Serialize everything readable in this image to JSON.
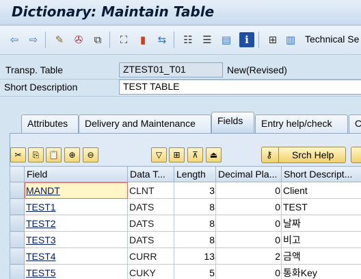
{
  "window": {
    "title": "Dictionary: Maintain Table"
  },
  "toolbar": {
    "buttons": [
      {
        "name": "back-arrow-icon",
        "glyph": "⇦",
        "color": "#3b73c9"
      },
      {
        "name": "forward-arrow-icon",
        "glyph": "⇨",
        "color": "#3b73c9"
      },
      {
        "name": "display-change-icon",
        "glyph": "✎",
        "color": "#8a6d1a"
      },
      {
        "name": "check-icon",
        "glyph": "✇",
        "color": "#b0303a"
      },
      {
        "name": "activate-icon",
        "glyph": "⧉",
        "color": "#333333"
      },
      {
        "name": "where-used-icon",
        "glyph": "⛶",
        "color": "#333333"
      },
      {
        "name": "object-list-icon",
        "glyph": "▮",
        "color": "#d63a1f"
      },
      {
        "name": "navigation-icon",
        "glyph": "⇆",
        "color": "#3b73c9"
      },
      {
        "name": "hierarchy-icon",
        "glyph": "☷",
        "color": "#333333"
      },
      {
        "name": "structure-icon",
        "glyph": "☰",
        "color": "#333333"
      },
      {
        "name": "layout-icon",
        "glyph": "▤",
        "color": "#3b73c9"
      },
      {
        "name": "info-icon",
        "glyph": "ℹ",
        "color": "#ffffff"
      },
      {
        "name": "indexes-icon",
        "glyph": "⊞",
        "color": "#333333"
      },
      {
        "name": "append-structure-icon",
        "glyph": "▥",
        "color": "#3b73c9"
      }
    ],
    "technical_settings_label": "Technical Se"
  },
  "header": {
    "transp_table_label": "Transp. Table",
    "transp_table_value": "ZTEST01_T01",
    "status": "New(Revised)",
    "short_description_label": "Short Description",
    "short_description_value": "TEST TABLE"
  },
  "tabs": [
    {
      "label": "Attributes",
      "active": false
    },
    {
      "label": "Delivery and Maintenance",
      "active": false
    },
    {
      "label": "Fields",
      "active": true
    },
    {
      "label": "Entry help/check",
      "active": false
    },
    {
      "label": "C",
      "active": false
    }
  ],
  "table_toolbar": {
    "buttons": [
      {
        "name": "cut-icon",
        "glyph": "✂"
      },
      {
        "name": "copy-icon",
        "glyph": "⎘"
      },
      {
        "name": "paste-icon",
        "glyph": "📋"
      },
      {
        "name": "insert-row-icon",
        "glyph": "⊕"
      },
      {
        "name": "delete-row-icon",
        "glyph": "⊖"
      },
      {
        "name": "filter-icon",
        "glyph": "▽"
      },
      {
        "name": "new-row-icon",
        "glyph": "⊞"
      },
      {
        "name": "first-page-icon",
        "glyph": "⊼"
      },
      {
        "name": "last-page-icon",
        "glyph": "⏏"
      }
    ],
    "search_help_label": "Srch Help"
  },
  "grid": {
    "columns": [
      "Field",
      "Data T...",
      "Length",
      "Decimal Pla...",
      "Short Descript..."
    ],
    "rows": [
      {
        "field": "MANDT",
        "data_type": "CLNT",
        "length": "3",
        "decimals": "0",
        "description": "Client"
      },
      {
        "field": "TEST1",
        "data_type": "DATS",
        "length": "8",
        "decimals": "0",
        "description": "TEST"
      },
      {
        "field": "TEST2",
        "data_type": "DATS",
        "length": "8",
        "decimals": "0",
        "description": "날짜"
      },
      {
        "field": "TEST3",
        "data_type": "DATS",
        "length": "8",
        "decimals": "0",
        "description": "비고"
      },
      {
        "field": "TEST4",
        "data_type": "CURR",
        "length": "13",
        "decimals": "2",
        "description": "금액"
      },
      {
        "field": "TEST5",
        "data_type": "CUKY",
        "length": "5",
        "decimals": "0",
        "description": "통화Key"
      }
    ]
  },
  "colors": {
    "accent": "#3b73c9",
    "focus_outline": "#e26a6a",
    "background": "#d5e4f1"
  }
}
